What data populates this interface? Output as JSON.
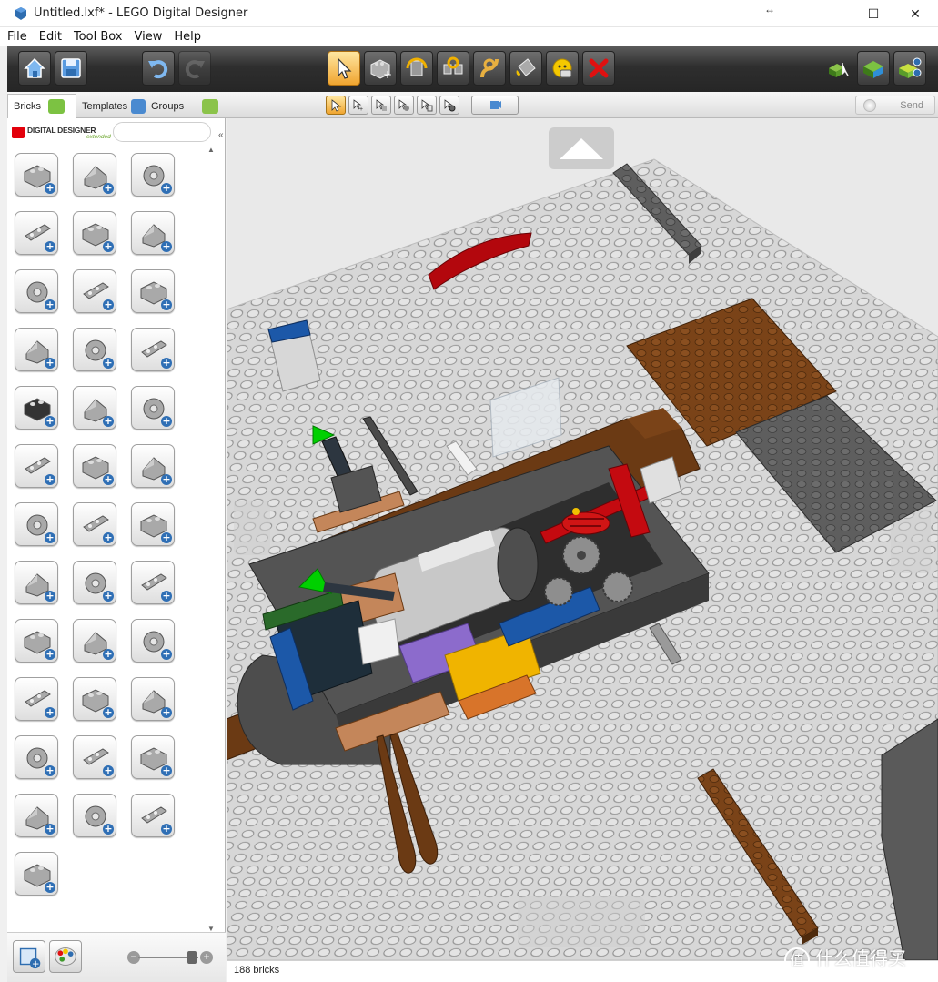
{
  "window": {
    "title": "Untitled.lxf* - LEGO Digital Designer",
    "minimize_glyph": "—",
    "maximize_glyph": "☐",
    "close_glyph": "✕",
    "resize_glyph": "↔"
  },
  "menu": [
    "File",
    "Edit",
    "Tool Box",
    "View",
    "Help"
  ],
  "toolbar": {
    "left_buttons": [
      "home-icon",
      "save-icon",
      "undo-icon",
      "redo-icon"
    ],
    "tool_buttons": [
      "select-tool-icon",
      "clone-tool-icon",
      "hinge-tool-icon",
      "hinge-align-tool-icon",
      "flex-tool-icon",
      "paint-bucket-icon",
      "hide-tool-icon",
      "delete-tool-icon"
    ],
    "right_buttons": [
      "build-mode-icon",
      "view-mode-icon",
      "building-guide-icon"
    ],
    "active_tool": "select-tool-icon"
  },
  "tabs": [
    {
      "label": "Bricks",
      "active": true
    },
    {
      "label": "Templates",
      "active": false
    },
    {
      "label": "Groups",
      "active": false
    }
  ],
  "selection_modes": [
    "single-select-icon",
    "multi-select-icon",
    "select-connected-icon",
    "select-same-color-icon",
    "select-same-shape-icon",
    "select-same-color-shape-icon"
  ],
  "send_button": {
    "label": "Send"
  },
  "palette": {
    "logo_text": "DIGITAL DESIGNER",
    "logo_sub": "extended",
    "search_value": "",
    "collapse_glyph": "«",
    "bricks": [
      "brick-2x2-icon",
      "round-brick-icon",
      "technic-brick-round-icon",
      "brick-1x4-icon",
      "slope-brick-icon",
      "wedge-brick-icon",
      "arch-brick-icon",
      "plate-2x2-icon",
      "wedge-plate-icon",
      "bracket-plate-icon",
      "tile-special-icon",
      "door-panel-icon",
      "wheel-icon",
      "technic-connector-icon",
      "technic-beam-icon",
      "technic-liftarm-icon",
      "axle-icon",
      "gear-icon",
      "curved-panel-icon",
      "cylinder-icon",
      "flex-panel-icon",
      "wrench-icon",
      "vehicle-part-icon",
      "frame-icon",
      "wing-icon",
      "steering-wheel-icon",
      "track-icon",
      "hose-reel-icon",
      "minifig-icon",
      "minifig-head-icon",
      "helmet-icon",
      "hat-icon",
      "skeleton-icon",
      "torso-icon",
      "hammer-icon",
      "accessory-icon",
      "animal-icon"
    ],
    "bottom_buttons": [
      "add-model-icon",
      "paint-palette-icon"
    ],
    "zoom_minus": "−",
    "zoom_plus": "+"
  },
  "status": {
    "brick_count": "188 bricks"
  },
  "watermark": {
    "glyph": "值",
    "text": "什么值得买"
  }
}
